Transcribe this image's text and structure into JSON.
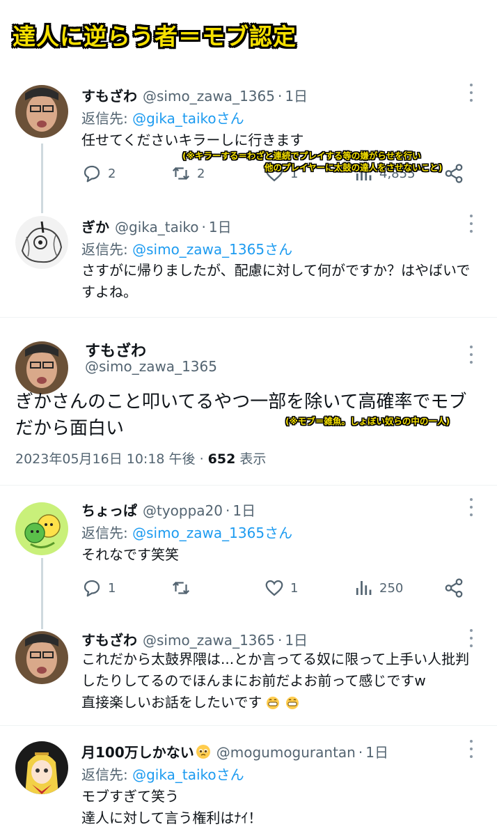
{
  "banner": {
    "title": "達人に逆らう者＝モブ認定"
  },
  "tweet1": {
    "name": "すもざわ",
    "handle": "@simo_zawa_1365",
    "time": "1日",
    "reply_prefix": "返信先:",
    "reply_target": "@gika_taikoさん",
    "text": "任せてくださいキラーしに行きます",
    "reply_count": "2",
    "retweet_count": "2",
    "like_count": "1",
    "view_count": "4,855",
    "annotation_line1": "(※キラーする＝わざと連続でプレイする等の嫌がらせを行い",
    "annotation_line2": "他のプレイヤーに太鼓の達人をさせないこと)"
  },
  "tweet2": {
    "name": "ぎか",
    "handle": "@gika_taiko",
    "time": "1日",
    "reply_prefix": "返信先:",
    "reply_target": "@simo_zawa_1365さん",
    "text_line1": "さすがに帰りましたが、配慮に対して何がですか？はやばいで",
    "text_line2": "すよね。"
  },
  "main_tweet": {
    "name": "すもざわ",
    "handle": "@simo_zawa_1365",
    "text_line1": "ぎかさんのこと叩いてるやつ一部を除いて高確率でモブ",
    "text_line2": "だから面白い",
    "annotation": "(※モブ＝雑魚。しょぼい奴らの中の一人)",
    "timestamp": "2023年05月16日 10:18 午後 · ",
    "views": "652",
    "views_label": " 表示"
  },
  "tweet3": {
    "name": "ちょっぱ",
    "handle": "@tyoppa20",
    "time": "1日",
    "reply_prefix": "返信先:",
    "reply_target": "@simo_zawa_1365さん",
    "text": "それなです笑笑",
    "reply_count": "1",
    "retweet_count": "",
    "like_count": "1",
    "view_count": "250"
  },
  "tweet4": {
    "name": "すもざわ",
    "handle": "@simo_zawa_1365",
    "time": "1日",
    "text_line1": "これだから太鼓界隈は...とか言ってる奴に限って上手い人批判",
    "text_line2": "したりしてるのでほんまにお前だよお前って感じですw",
    "text_line3": "直接楽しいお話をしたいです"
  },
  "tweet5": {
    "name": "月100万しかない",
    "handle": "@mogumogurantan",
    "time": "1日",
    "reply_prefix": "返信先:",
    "reply_target": "@gika_taikoさん",
    "text_line1": "モブすぎて笑う",
    "text_line2": "達人に対して言う権利はﾅｲ！"
  },
  "colors": {
    "link": "#1d9bf0",
    "secondary": "#536471",
    "annotation": "#f5e000"
  },
  "icons": [
    "reply-icon",
    "retweet-icon",
    "like-icon",
    "views-icon",
    "share-icon",
    "more-icon"
  ]
}
